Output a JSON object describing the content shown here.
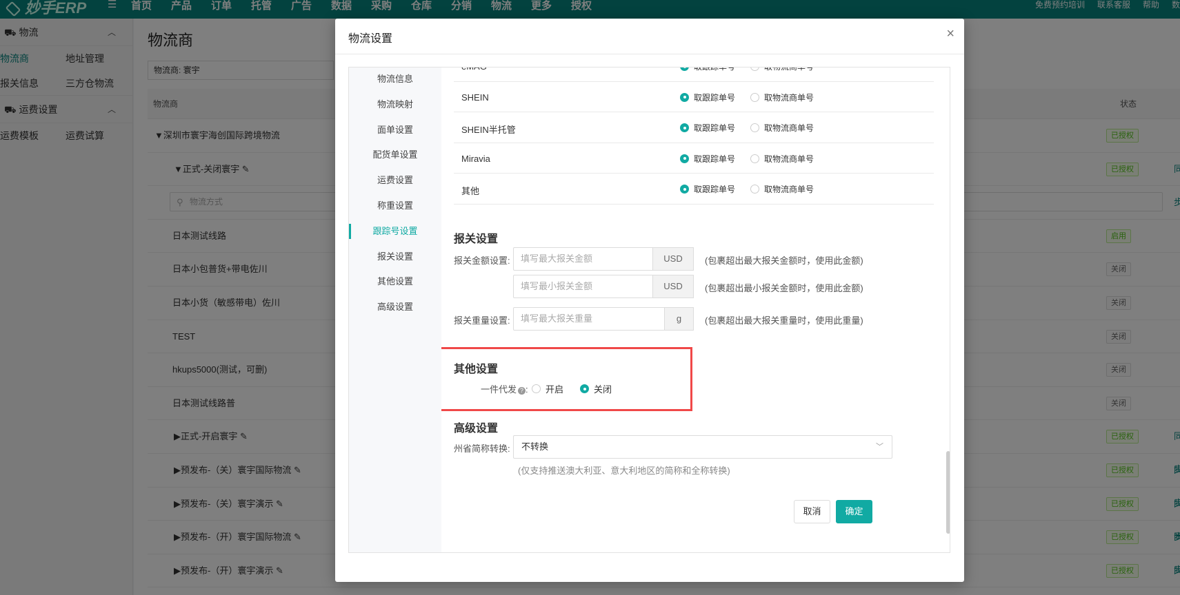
{
  "topnav": {
    "logo": "妙手ERP",
    "items": [
      "首页",
      "产品",
      "订单",
      "托管",
      "广告",
      "数据",
      "采购",
      "仓库",
      "分销",
      "物流",
      "更多",
      "授权"
    ],
    "right": [
      "免费预约培训",
      "联系客服",
      "帮助",
      "数"
    ]
  },
  "sidebar": {
    "groups": [
      {
        "label": "物流",
        "rows": [
          [
            "物流商",
            "地址管理"
          ],
          [
            "报关信息",
            "三方仓物流"
          ]
        ]
      },
      {
        "label": "运费设置",
        "rows": [
          [
            "运费模板",
            "运费试算"
          ]
        ]
      }
    ]
  },
  "main": {
    "title": "物流商",
    "filter": "物流商:  寰宇",
    "col_provider": "物流商",
    "col_state": "状态",
    "search_placeholder": "物流方式",
    "rows": [
      {
        "text": "▼深圳市寰宇海创国际跨境物流",
        "status": "已授权",
        "indent": 10,
        "sync": ""
      },
      {
        "text": "▼正式-关闭寰宇 ✎",
        "status": "已授权",
        "indent": 38,
        "sync": "同步"
      },
      {
        "text": "",
        "status": "",
        "indent": 0,
        "sync": "",
        "search": true
      },
      {
        "text": "日本测试线路",
        "status": "启用",
        "indent": 36,
        "sync": ""
      },
      {
        "text": "日本小包普货+带电佐川",
        "status": "关闭",
        "indent": 36,
        "sync": ""
      },
      {
        "text": "日本小货（敏感带电）佐川",
        "status": "关闭",
        "indent": 36,
        "sync": ""
      },
      {
        "text": "TEST",
        "status": "关闭",
        "indent": 36,
        "sync": ""
      },
      {
        "text": "hkups5000(测试，可删)",
        "status": "关闭",
        "indent": 36,
        "sync": ""
      },
      {
        "text": "日本测试线路普",
        "status": "关闭",
        "indent": 36,
        "sync": ""
      },
      {
        "text": "▶正式-开启寰宇 ✎",
        "status": "已授权",
        "indent": 38,
        "sync": "同步"
      },
      {
        "text": "▶预发布-（关）寰宇国际物流 ✎",
        "status": "已授权",
        "indent": 38,
        "sync": "同步"
      },
      {
        "text": "▶预发布-（关）寰宇演示 ✎",
        "status": "已授权",
        "indent": 38,
        "sync": "同步"
      },
      {
        "text": "▶预发布-（开）寰宇国际物流 ✎",
        "status": "已授权",
        "indent": 38,
        "sync": "同步"
      },
      {
        "text": "▶预发布-（开）寰宇演示 ✎",
        "status": "已授权",
        "indent": 38,
        "sync": "同步"
      }
    ]
  },
  "modal": {
    "title": "物流设置",
    "close": "×",
    "menu": [
      "物流信息",
      "物流映射",
      "面单设置",
      "配货单设置",
      "运费设置",
      "称重设置",
      "跟踪号设置",
      "报关设置",
      "其他设置",
      "高级设置"
    ],
    "menu_active": 6,
    "tracking": {
      "opt_a": "取跟踪单号",
      "opt_b": "取物流商单号",
      "rows": [
        "eMAG",
        "SHEIN",
        "SHEIN半托管",
        "Miravia",
        "其他"
      ]
    },
    "customs": {
      "title": "报关设置",
      "amount_label": "报关金额设置:",
      "max_amount_placeholder": "填写最大报关金额",
      "min_amount_placeholder": "填写最小报关金额",
      "currency": "USD",
      "max_amount_hint": "(包裹超出最大报关金额时，使用此金额)",
      "min_amount_hint": "(包裹超出最小报关金额时，使用此金额)",
      "weight_label": "报关重量设置:",
      "max_weight_placeholder": "填写最大报关重量",
      "weight_unit": "g",
      "max_weight_hint": "(包裹超出最大报关重量时，使用此重量)"
    },
    "other": {
      "title": "其他设置",
      "dropship_label": "一件代发",
      "help": "?",
      "colon": ":",
      "on": "开启",
      "off": "关闭",
      "selected": "off"
    },
    "advanced": {
      "title": "高级设置",
      "state_label": "州省简称转换:",
      "state_value": "不转换",
      "state_hint": "(仅支持推送澳大利亚、意大利地区的简称和全称转换)"
    },
    "cancel": "取消",
    "ok": "确定"
  },
  "colors": {
    "accent": "#11aaa3",
    "nav": "#07847f",
    "highlight": "#f04848"
  }
}
